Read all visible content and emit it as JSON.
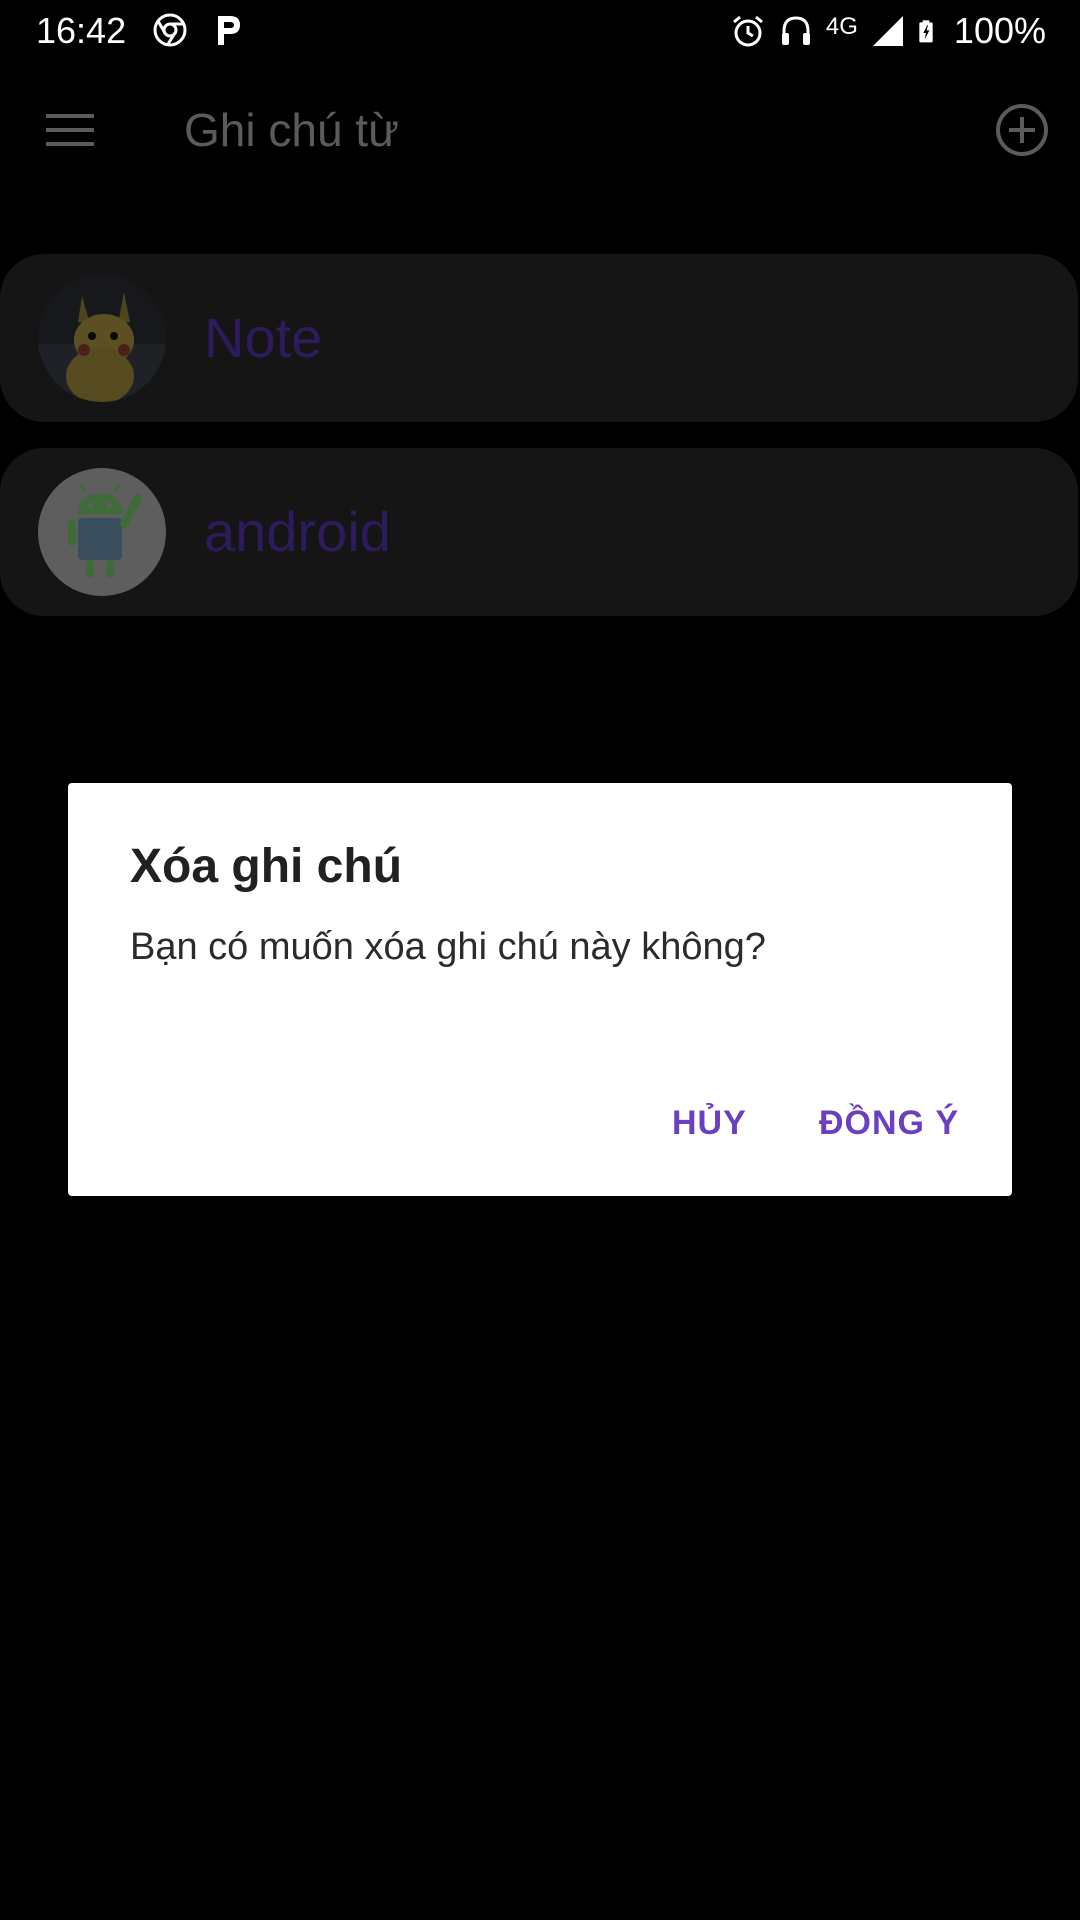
{
  "status_bar": {
    "time": "16:42",
    "network": "4G",
    "battery": "100%",
    "icons": [
      "chrome-icon",
      "p-icon",
      "alarm-icon",
      "headset-icon",
      "signal-icon",
      "battery-icon"
    ]
  },
  "app_bar": {
    "title": "Ghi chú từ",
    "menu_icon": "menu-icon",
    "add_icon": "add-circle-icon"
  },
  "notes": [
    {
      "label": "Note",
      "avatar": "pikachu-avatar"
    },
    {
      "label": "android",
      "avatar": "android-avatar"
    }
  ],
  "dialog": {
    "title": "Xóa ghi chú",
    "message": "Bạn có muốn xóa ghi chú này không?",
    "cancel_label": "HỦY",
    "ok_label": "ĐỒNG Ý"
  },
  "colors": {
    "accent": "#6a3fc0",
    "background": "#000000",
    "card": "#151515",
    "dialog": "#ffffff"
  }
}
